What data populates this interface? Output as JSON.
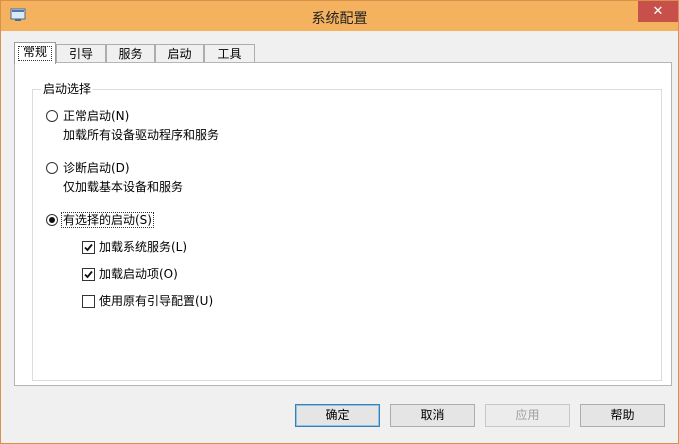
{
  "window": {
    "title": "系统配置",
    "close_label": "✕"
  },
  "tabs": [
    {
      "label": "常规",
      "active": true
    },
    {
      "label": "引导",
      "active": false
    },
    {
      "label": "服务",
      "active": false
    },
    {
      "label": "启动",
      "active": false
    },
    {
      "label": "工具",
      "active": false
    }
  ],
  "startup_group": {
    "legend": "启动选择",
    "normal": {
      "label": "正常启动(N)",
      "description": "加载所有设备驱动程序和服务",
      "selected": false
    },
    "diagnostic": {
      "label": "诊断启动(D)",
      "description": "仅加载基本设备和服务",
      "selected": false
    },
    "selective": {
      "label": "有选择的启动(S)",
      "selected": true,
      "options": [
        {
          "label": "加载系统服务(L)",
          "checked": true
        },
        {
          "label": "加载启动项(O)",
          "checked": true
        },
        {
          "label": "使用原有引导配置(U)",
          "checked": false
        }
      ]
    }
  },
  "buttons": {
    "ok": "确定",
    "cancel": "取消",
    "apply": "应用",
    "help": "帮助"
  }
}
